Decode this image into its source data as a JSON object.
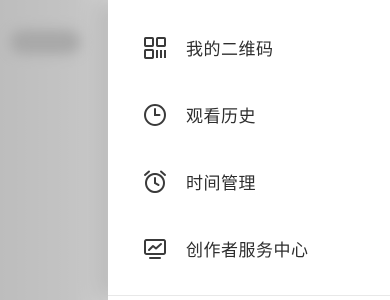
{
  "menu": {
    "items": [
      {
        "label": "我的二维码",
        "icon": "qr-code-icon"
      },
      {
        "label": "观看历史",
        "icon": "clock-icon"
      },
      {
        "label": "时间管理",
        "icon": "alarm-clock-icon"
      },
      {
        "label": "创作者服务中心",
        "icon": "chart-monitor-icon"
      }
    ]
  }
}
